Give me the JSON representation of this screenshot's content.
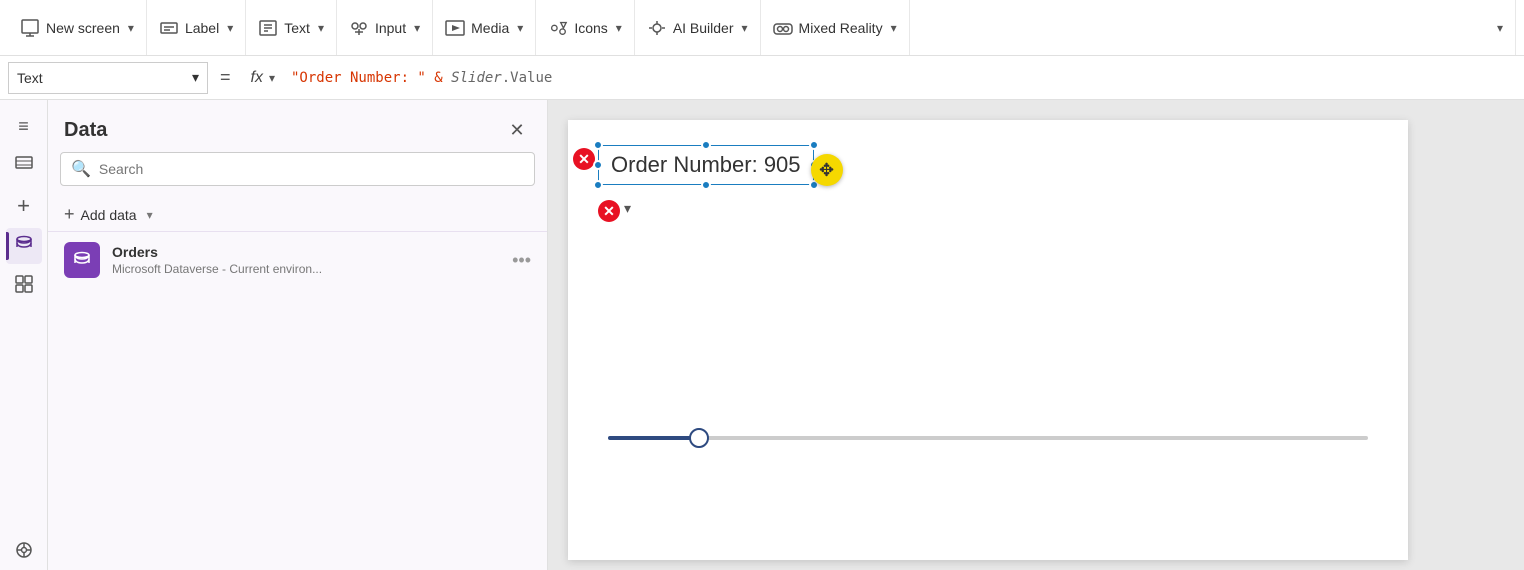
{
  "toolbar": {
    "new_screen_label": "New screen",
    "label_label": "Label",
    "text_label": "Text",
    "input_label": "Input",
    "media_label": "Media",
    "icons_label": "Icons",
    "ai_builder_label": "AI Builder",
    "mixed_reality_label": "Mixed Reality"
  },
  "formula_bar": {
    "property_name": "Text",
    "fx_label": "fx",
    "expression": "\"Order Number: \" & Slider.Value"
  },
  "data_panel": {
    "title": "Data",
    "search_placeholder": "Search",
    "add_data_label": "Add data",
    "source": {
      "name": "Orders",
      "description": "Microsoft Dataverse - Current environ..."
    }
  },
  "canvas": {
    "text_content": "Order Number: 905"
  },
  "sidebar": {
    "items": [
      {
        "icon": "≡",
        "name": "menu-icon"
      },
      {
        "icon": "⧉",
        "name": "layers-icon"
      },
      {
        "icon": "+",
        "name": "add-icon"
      },
      {
        "icon": "🗄",
        "name": "data-icon"
      },
      {
        "icon": "⊞",
        "name": "components-icon"
      },
      {
        "icon": "⚙",
        "name": "tools-icon"
      }
    ]
  }
}
